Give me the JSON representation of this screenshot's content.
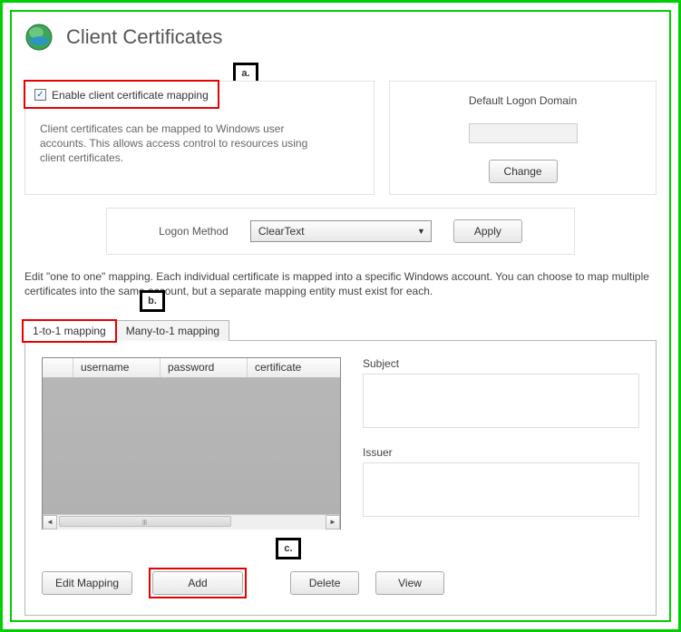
{
  "header": {
    "title": "Client Certificates"
  },
  "callouts": {
    "a": "a.",
    "b": "b.",
    "c": "c."
  },
  "enable": {
    "checked": true,
    "label": "Enable client certificate mapping",
    "description": "Client certificates can be mapped to Windows user accounts. This allows access control to resources using client certificates."
  },
  "domain_panel": {
    "title": "Default Logon Domain",
    "value": "",
    "change_label": "Change"
  },
  "logon": {
    "label": "Logon Method",
    "selected": "ClearText",
    "apply_label": "Apply"
  },
  "explain_text": "Edit \"one to one\" mapping. Each individual certificate is mapped into a specific Windows account. You can choose to map multiple certificates into the same account, but a separate mapping entity must exist for each.",
  "tabs": {
    "one": "1-to-1 mapping",
    "many": "Many-to-1 mapping"
  },
  "grid": {
    "columns": [
      "",
      "username",
      "password",
      "certificate"
    ],
    "rows": []
  },
  "details": {
    "subject_label": "Subject",
    "subject_value": "",
    "issuer_label": "Issuer",
    "issuer_value": ""
  },
  "buttons": {
    "edit": "Edit Mapping",
    "add": "Add",
    "delete": "Delete",
    "view": "View"
  }
}
